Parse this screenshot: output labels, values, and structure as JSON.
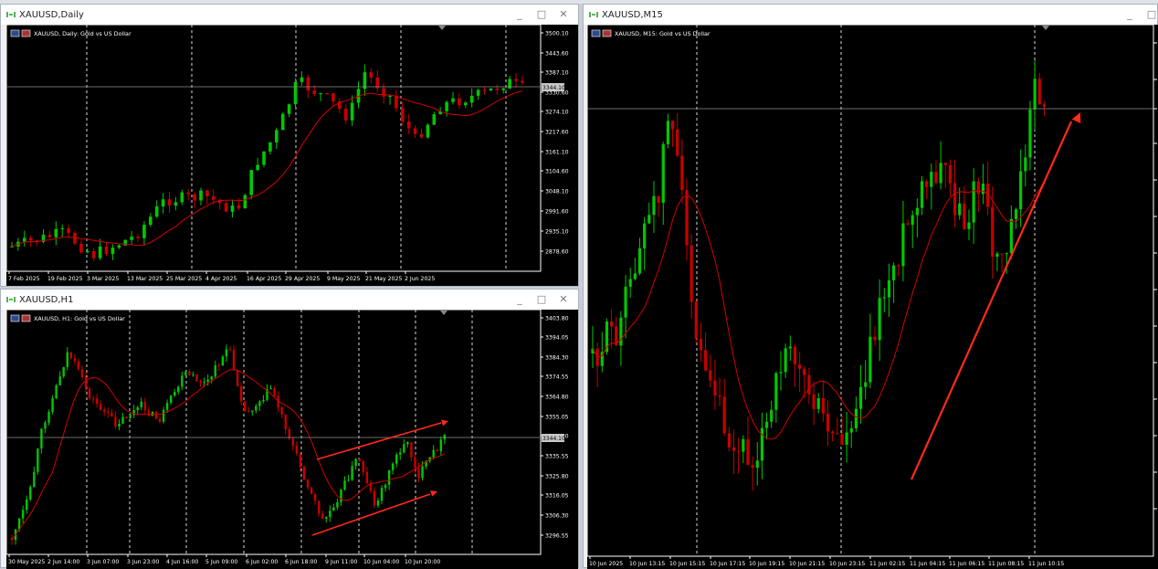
{
  "windows": {
    "daily": {
      "title": "XAUUSD,Daily",
      "label": "XAUUSD, Daily:  Gold vs US Dollar",
      "price_tag": "3344.10",
      "yticks": [
        "3500.10",
        "3443.60",
        "3387.10",
        "3330.60",
        "3274.10",
        "3217.60",
        "3161.10",
        "3104.60",
        "3048.10",
        "2991.60",
        "2935.10",
        "2878.60"
      ],
      "xticks": [
        "7 Feb 2025",
        "19 Feb 2025",
        "3 Mar 2025",
        "13 Mar 2025",
        "25 Mar 2025",
        "4 Apr 2025",
        "16 Apr 2025",
        "29 Apr 2025",
        "9 May 2025",
        "21 May 2025",
        "2 Jun 2025"
      ]
    },
    "h1": {
      "title": "XAUUSD,H1",
      "label": "XAUUSD, H1:  Gold vs US Dollar",
      "price_tag": "3344.10",
      "yticks": [
        "3403.80",
        "3394.05",
        "3384.30",
        "3374.55",
        "3364.80",
        "3355.05",
        "3345.30",
        "3335.55",
        "3325.80",
        "3316.05",
        "3306.30",
        "3296.55"
      ],
      "xticks": [
        "30 May 2025",
        "2 Jun 14:00",
        "3 Jun 07:00",
        "3 Jun 23:00",
        "4 Jun 16:00",
        "5 Jun 09:00",
        "6 Jun 02:00",
        "6 Jun 18:00",
        "9 Jun 11:00",
        "10 Jun 04:00",
        "10 Jun 20:00"
      ]
    },
    "m15": {
      "title": "XAUUSD,M15",
      "label": "XAUUSD, M15:  Gold vs US Dollar",
      "xticks": [
        "10 Jun 2025",
        "10 Jun 13:15",
        "10 Jun 15:15",
        "10 Jun 17:15",
        "10 Jun 19:15",
        "10 Jun 21:15",
        "10 Jun 23:15",
        "11 Jun 02:15",
        "11 Jun 04:15",
        "11 Jun 06:15",
        "11 Jun 08:15",
        "11 Jun 10:15"
      ]
    }
  },
  "controls": {
    "minimize": "_",
    "maximize": "□",
    "close": "✕"
  },
  "icons": {
    "window": "chart-window-icon",
    "flag": "flag-icon",
    "instrument": "instrument-icon"
  },
  "colors": {
    "bull": "#00c800",
    "bear": "#c80000",
    "ma": "#d40000",
    "arrow": "#ff2a1a",
    "grid": "#d9d9d9",
    "axis": "#ffffff"
  }
}
